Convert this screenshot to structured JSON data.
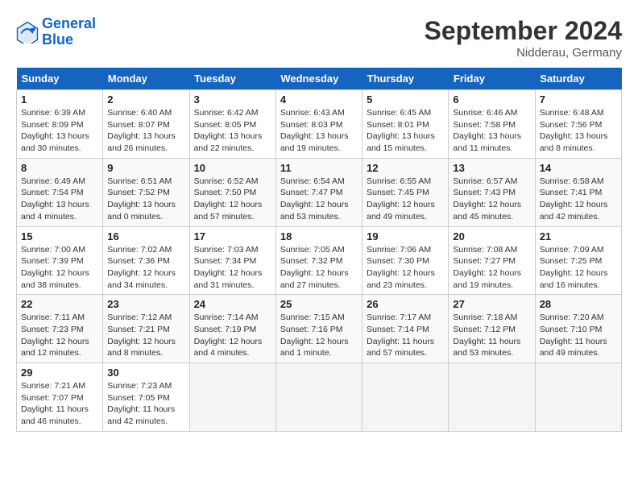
{
  "header": {
    "logo_line1": "General",
    "logo_line2": "Blue",
    "month": "September 2024",
    "location": "Nidderau, Germany"
  },
  "weekdays": [
    "Sunday",
    "Monday",
    "Tuesday",
    "Wednesday",
    "Thursday",
    "Friday",
    "Saturday"
  ],
  "weeks": [
    [
      {
        "day": "1",
        "sunrise": "6:39 AM",
        "sunset": "8:09 PM",
        "daylight": "13 hours and 30 minutes."
      },
      {
        "day": "2",
        "sunrise": "6:40 AM",
        "sunset": "8:07 PM",
        "daylight": "13 hours and 26 minutes."
      },
      {
        "day": "3",
        "sunrise": "6:42 AM",
        "sunset": "8:05 PM",
        "daylight": "13 hours and 22 minutes."
      },
      {
        "day": "4",
        "sunrise": "6:43 AM",
        "sunset": "8:03 PM",
        "daylight": "13 hours and 19 minutes."
      },
      {
        "day": "5",
        "sunrise": "6:45 AM",
        "sunset": "8:01 PM",
        "daylight": "13 hours and 15 minutes."
      },
      {
        "day": "6",
        "sunrise": "6:46 AM",
        "sunset": "7:58 PM",
        "daylight": "13 hours and 11 minutes."
      },
      {
        "day": "7",
        "sunrise": "6:48 AM",
        "sunset": "7:56 PM",
        "daylight": "13 hours and 8 minutes."
      }
    ],
    [
      {
        "day": "8",
        "sunrise": "6:49 AM",
        "sunset": "7:54 PM",
        "daylight": "13 hours and 4 minutes."
      },
      {
        "day": "9",
        "sunrise": "6:51 AM",
        "sunset": "7:52 PM",
        "daylight": "13 hours and 0 minutes."
      },
      {
        "day": "10",
        "sunrise": "6:52 AM",
        "sunset": "7:50 PM",
        "daylight": "12 hours and 57 minutes."
      },
      {
        "day": "11",
        "sunrise": "6:54 AM",
        "sunset": "7:47 PM",
        "daylight": "12 hours and 53 minutes."
      },
      {
        "day": "12",
        "sunrise": "6:55 AM",
        "sunset": "7:45 PM",
        "daylight": "12 hours and 49 minutes."
      },
      {
        "day": "13",
        "sunrise": "6:57 AM",
        "sunset": "7:43 PM",
        "daylight": "12 hours and 45 minutes."
      },
      {
        "day": "14",
        "sunrise": "6:58 AM",
        "sunset": "7:41 PM",
        "daylight": "12 hours and 42 minutes."
      }
    ],
    [
      {
        "day": "15",
        "sunrise": "7:00 AM",
        "sunset": "7:39 PM",
        "daylight": "12 hours and 38 minutes."
      },
      {
        "day": "16",
        "sunrise": "7:02 AM",
        "sunset": "7:36 PM",
        "daylight": "12 hours and 34 minutes."
      },
      {
        "day": "17",
        "sunrise": "7:03 AM",
        "sunset": "7:34 PM",
        "daylight": "12 hours and 31 minutes."
      },
      {
        "day": "18",
        "sunrise": "7:05 AM",
        "sunset": "7:32 PM",
        "daylight": "12 hours and 27 minutes."
      },
      {
        "day": "19",
        "sunrise": "7:06 AM",
        "sunset": "7:30 PM",
        "daylight": "12 hours and 23 minutes."
      },
      {
        "day": "20",
        "sunrise": "7:08 AM",
        "sunset": "7:27 PM",
        "daylight": "12 hours and 19 minutes."
      },
      {
        "day": "21",
        "sunrise": "7:09 AM",
        "sunset": "7:25 PM",
        "daylight": "12 hours and 16 minutes."
      }
    ],
    [
      {
        "day": "22",
        "sunrise": "7:11 AM",
        "sunset": "7:23 PM",
        "daylight": "12 hours and 12 minutes."
      },
      {
        "day": "23",
        "sunrise": "7:12 AM",
        "sunset": "7:21 PM",
        "daylight": "12 hours and 8 minutes."
      },
      {
        "day": "24",
        "sunrise": "7:14 AM",
        "sunset": "7:19 PM",
        "daylight": "12 hours and 4 minutes."
      },
      {
        "day": "25",
        "sunrise": "7:15 AM",
        "sunset": "7:16 PM",
        "daylight": "12 hours and 1 minute."
      },
      {
        "day": "26",
        "sunrise": "7:17 AM",
        "sunset": "7:14 PM",
        "daylight": "11 hours and 57 minutes."
      },
      {
        "day": "27",
        "sunrise": "7:18 AM",
        "sunset": "7:12 PM",
        "daylight": "11 hours and 53 minutes."
      },
      {
        "day": "28",
        "sunrise": "7:20 AM",
        "sunset": "7:10 PM",
        "daylight": "11 hours and 49 minutes."
      }
    ],
    [
      {
        "day": "29",
        "sunrise": "7:21 AM",
        "sunset": "7:07 PM",
        "daylight": "11 hours and 46 minutes."
      },
      {
        "day": "30",
        "sunrise": "7:23 AM",
        "sunset": "7:05 PM",
        "daylight": "11 hours and 42 minutes."
      },
      null,
      null,
      null,
      null,
      null
    ]
  ]
}
